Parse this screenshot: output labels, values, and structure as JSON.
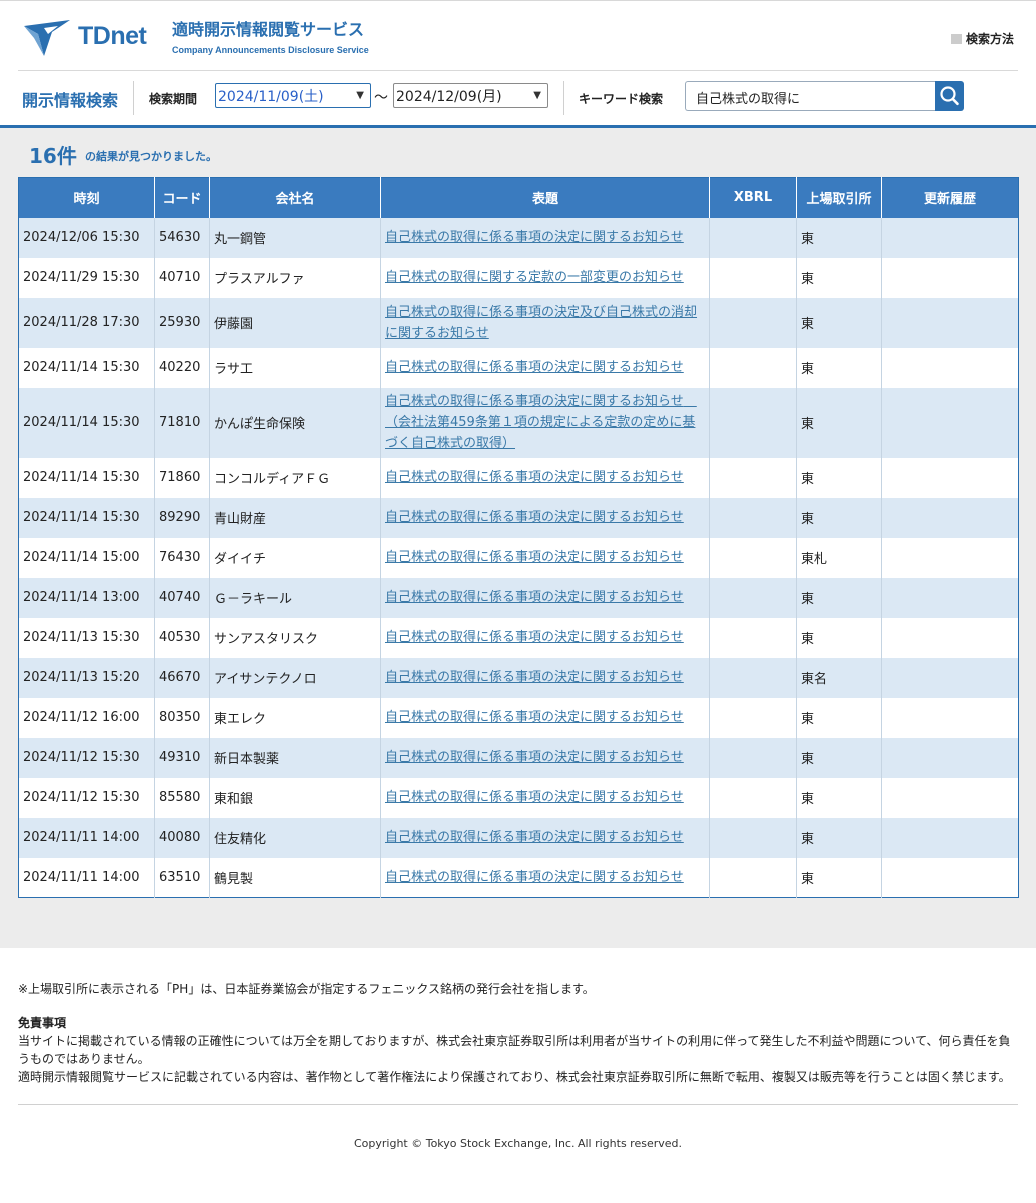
{
  "header": {
    "logo_text": "TDnet",
    "site_title": "適時開示情報閲覧サービス",
    "site_subtitle": "Company Announcements Disclosure Service",
    "help_link": "検索方法",
    "brand_color": "#2a6fb0"
  },
  "search": {
    "title": "開示情報検索",
    "period_label": "検索期間",
    "date_from": "2024/11/09(土)",
    "date_to": "2024/12/09(月)",
    "tilde": "～",
    "keyword_label": "キーワード検索",
    "keyword_value": "自己株式の取得に",
    "search_icon": "search-icon"
  },
  "results": {
    "count": "16件",
    "count_text": "の結果が見つかりました。",
    "columns": [
      "時刻",
      "コード",
      "会社名",
      "表題",
      "XBRL",
      "上場取引所",
      "更新履歴"
    ],
    "rows": [
      {
        "time": "2024/12/06 15:30",
        "code": "54630",
        "company": "丸一鋼管",
        "title": "自己株式の取得に係る事項の決定に関するお知らせ",
        "xbrl": "",
        "exchange": "東",
        "history": ""
      },
      {
        "time": "2024/11/29 15:30",
        "code": "40710",
        "company": "プラスアルファ",
        "title": "自己株式の取得に関する定款の一部変更のお知らせ",
        "xbrl": "",
        "exchange": "東",
        "history": ""
      },
      {
        "time": "2024/11/28 17:30",
        "code": "25930",
        "company": "伊藤園",
        "title": "自己株式の取得に係る事項の決定及び自己株式の消却に関するお知らせ",
        "xbrl": "",
        "exchange": "東",
        "history": ""
      },
      {
        "time": "2024/11/14 15:30",
        "code": "40220",
        "company": "ラサ工",
        "title": "自己株式の取得に係る事項の決定に関するお知らせ",
        "xbrl": "",
        "exchange": "東",
        "history": ""
      },
      {
        "time": "2024/11/14 15:30",
        "code": "71810",
        "company": "かんぽ生命保険",
        "title": "自己株式の取得に係る事項の決定に関するお知らせ　（会社法第459条第１項の規定による定款の定めに基づく自己株式の取得）",
        "xbrl": "",
        "exchange": "東",
        "history": ""
      },
      {
        "time": "2024/11/14 15:30",
        "code": "71860",
        "company": "コンコルディアＦＧ",
        "title": "自己株式の取得に係る事項の決定に関するお知らせ",
        "xbrl": "",
        "exchange": "東",
        "history": ""
      },
      {
        "time": "2024/11/14 15:30",
        "code": "89290",
        "company": "青山財産",
        "title": "自己株式の取得に係る事項の決定に関するお知らせ",
        "xbrl": "",
        "exchange": "東",
        "history": ""
      },
      {
        "time": "2024/11/14 15:00",
        "code": "76430",
        "company": "ダイイチ",
        "title": "自己株式の取得に係る事項の決定に関するお知らせ",
        "xbrl": "",
        "exchange": "東札",
        "history": ""
      },
      {
        "time": "2024/11/14 13:00",
        "code": "40740",
        "company": "Ｇ－ラキール",
        "title": "自己株式の取得に係る事項の決定に関するお知らせ",
        "xbrl": "",
        "exchange": "東",
        "history": ""
      },
      {
        "time": "2024/11/13 15:30",
        "code": "40530",
        "company": "サンアスタリスク",
        "title": "自己株式の取得に係る事項の決定に関するお知らせ",
        "xbrl": "",
        "exchange": "東",
        "history": ""
      },
      {
        "time": "2024/11/13 15:20",
        "code": "46670",
        "company": "アイサンテクノロ",
        "title": "自己株式の取得に係る事項の決定に関するお知らせ",
        "xbrl": "",
        "exchange": "東名",
        "history": ""
      },
      {
        "time": "2024/11/12 16:00",
        "code": "80350",
        "company": "東エレク",
        "title": "自己株式の取得に係る事項の決定に関するお知らせ",
        "xbrl": "",
        "exchange": "東",
        "history": ""
      },
      {
        "time": "2024/11/12 15:30",
        "code": "49310",
        "company": "新日本製薬",
        "title": "自己株式の取得に係る事項の決定に関するお知らせ",
        "xbrl": "",
        "exchange": "東",
        "history": ""
      },
      {
        "time": "2024/11/12 15:30",
        "code": "85580",
        "company": "東和銀",
        "title": "自己株式の取得に係る事項の決定に関するお知らせ",
        "xbrl": "",
        "exchange": "東",
        "history": ""
      },
      {
        "time": "2024/11/11 14:00",
        "code": "40080",
        "company": "住友精化",
        "title": "自己株式の取得に係る事項の決定に関するお知らせ",
        "xbrl": "",
        "exchange": "東",
        "history": ""
      },
      {
        "time": "2024/11/11 14:00",
        "code": "63510",
        "company": "鶴見製",
        "title": "自己株式の取得に係る事項の決定に関するお知らせ",
        "xbrl": "",
        "exchange": "東",
        "history": ""
      }
    ]
  },
  "footer": {
    "note": "※上場取引所に表示される「PH」は、日本証券業協会が指定するフェニックス銘柄の発行会社を指します。",
    "disclaimer_title": "免責事項",
    "disclaimer_1": "当サイトに掲載されている情報の正確性については万全を期しておりますが、株式会社東京証券取引所は利用者が当サイトの利用に伴って発生した不利益や問題について、何ら責任を負うものではありません。",
    "disclaimer_2": "適時開示情報閲覧サービスに記載されている内容は、著作物として著作権法により保護されており、株式会社東京証券取引所に無断で転用、複製又は販売等を行うことは固く禁じます。",
    "copyright": "Copyright © Tokyo Stock Exchange, Inc. All rights reserved."
  }
}
